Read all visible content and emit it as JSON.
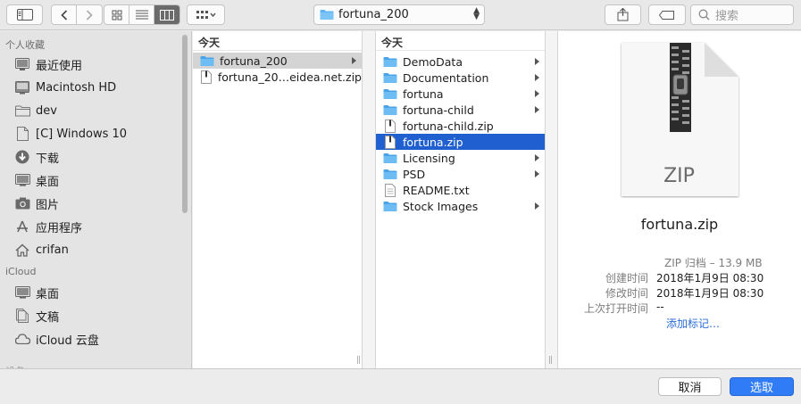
{
  "toolbar": {
    "path_label": "fortuna_200",
    "search_placeholder": "搜索"
  },
  "sidebar": {
    "favorites_header": "个人收藏",
    "favorites": [
      {
        "label": "最近使用",
        "icon": "recents-icon"
      },
      {
        "label": "Macintosh HD",
        "icon": "harddrive-icon"
      },
      {
        "label": "dev",
        "icon": "folder-icon"
      },
      {
        "label": "[C] Windows 10",
        "icon": "document-icon"
      },
      {
        "label": "下载",
        "icon": "downloads-icon"
      },
      {
        "label": "桌面",
        "icon": "desktop-icon"
      },
      {
        "label": "图片",
        "icon": "camera-icon"
      },
      {
        "label": "应用程序",
        "icon": "applications-icon"
      },
      {
        "label": "crifan",
        "icon": "home-icon"
      }
    ],
    "icloud_header": "iCloud",
    "icloud": [
      {
        "label": "桌面",
        "icon": "desktop-icon"
      },
      {
        "label": "文稿",
        "icon": "documents-icon"
      },
      {
        "label": "iCloud 云盘",
        "icon": "cloud-icon"
      }
    ],
    "tail_header": "设备"
  },
  "column1": {
    "header": "今天",
    "items": [
      {
        "label": "fortuna_200",
        "type": "folder",
        "arrow": true,
        "selected": "grey"
      },
      {
        "label": "fortuna_20…eidea.net.zip",
        "type": "zip",
        "arrow": false,
        "selected": ""
      }
    ]
  },
  "column2": {
    "header": "今天",
    "items": [
      {
        "label": "DemoData",
        "type": "folder",
        "arrow": true,
        "selected": ""
      },
      {
        "label": "Documentation",
        "type": "folder",
        "arrow": true,
        "selected": ""
      },
      {
        "label": "fortuna",
        "type": "folder",
        "arrow": true,
        "selected": ""
      },
      {
        "label": "fortuna-child",
        "type": "folder",
        "arrow": true,
        "selected": ""
      },
      {
        "label": "fortuna-child.zip",
        "type": "zip",
        "arrow": false,
        "selected": ""
      },
      {
        "label": "fortuna.zip",
        "type": "zip",
        "arrow": false,
        "selected": "blue"
      },
      {
        "label": "Licensing",
        "type": "folder",
        "arrow": true,
        "selected": ""
      },
      {
        "label": "PSD",
        "type": "folder",
        "arrow": true,
        "selected": ""
      },
      {
        "label": "README.txt",
        "type": "text",
        "arrow": false,
        "selected": ""
      },
      {
        "label": "Stock Images",
        "type": "folder",
        "arrow": true,
        "selected": ""
      }
    ]
  },
  "preview": {
    "icon_label": "ZIP",
    "filename": "fortuna.zip",
    "kind": "ZIP 归档 – 13.9 MB",
    "created_label": "创建时间",
    "created_value": "2018年1月9日 08:30",
    "modified_label": "修改时间",
    "modified_value": "2018年1月9日 08:30",
    "opened_label": "上次打开时间",
    "opened_value": "--",
    "add_tags": "添加标记…"
  },
  "buttons": {
    "cancel": "取消",
    "choose": "选取"
  },
  "colors": {
    "accent": "#2f7cf6",
    "selection": "#1f5fcf",
    "folder": "#5fb6f2"
  }
}
